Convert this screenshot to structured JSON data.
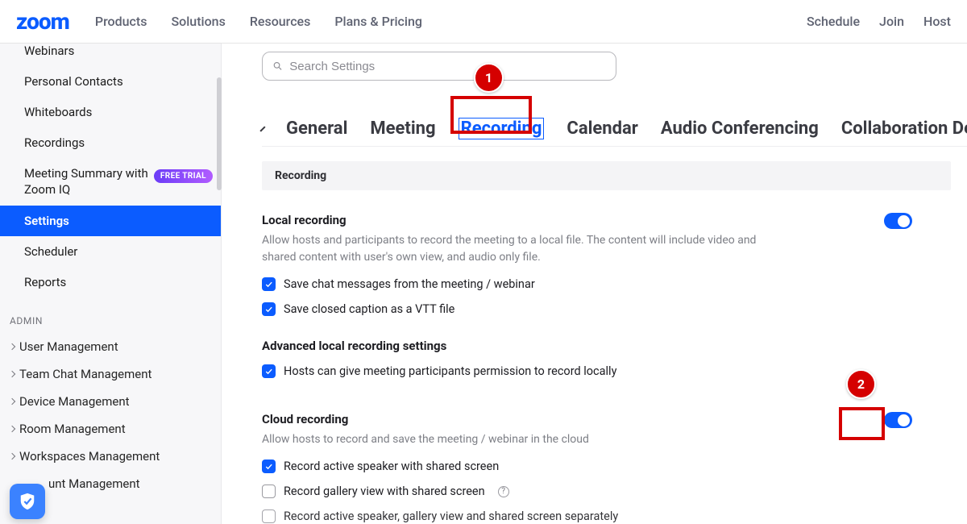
{
  "header": {
    "logo": "zoom",
    "nav_left": [
      "Products",
      "Solutions",
      "Resources",
      "Plans & Pricing"
    ],
    "nav_right": [
      "Schedule",
      "Join",
      "Host"
    ]
  },
  "sidebar": {
    "items": [
      {
        "label": "Webinars",
        "cut_top": true
      },
      {
        "label": "Personal Contacts"
      },
      {
        "label": "Whiteboards"
      },
      {
        "label": "Recordings"
      },
      {
        "label": "Meeting Summary with Zoom IQ",
        "badge": "FREE TRIAL"
      },
      {
        "label": "Settings",
        "active": true
      },
      {
        "label": "Scheduler"
      },
      {
        "label": "Reports"
      }
    ],
    "admin_heading": "ADMIN",
    "admin_items": [
      "User Management",
      "Team Chat Management",
      "Device Management",
      "Room Management",
      "Workspaces Management",
      "unt Management"
    ]
  },
  "main": {
    "search_placeholder": "Search Settings",
    "tabs": [
      "General",
      "Meeting",
      "Recording",
      "Calendar",
      "Audio Conferencing",
      "Collaboration Devices"
    ],
    "active_tab": "Recording",
    "section_bar": "Recording",
    "local": {
      "title": "Local recording",
      "desc": "Allow hosts and participants to record the meeting to a local file. The content will include video and shared content with user's own view, and audio only file.",
      "chk1": "Save chat messages from the meeting / webinar",
      "chk2": "Save closed caption as a VTT file",
      "adv_title": "Advanced local recording settings",
      "chk3": "Hosts can give meeting participants permission to record locally",
      "toggle_on": true
    },
    "cloud": {
      "title": "Cloud recording",
      "desc": "Allow hosts to record and save the meeting / webinar in the cloud",
      "chk1": "Record active speaker with shared screen",
      "chk2": "Record gallery view with shared screen",
      "chk3": "Record active speaker, gallery view and shared screen separately",
      "toggle_on": true
    }
  },
  "annotations": {
    "1": "1",
    "2": "2"
  }
}
